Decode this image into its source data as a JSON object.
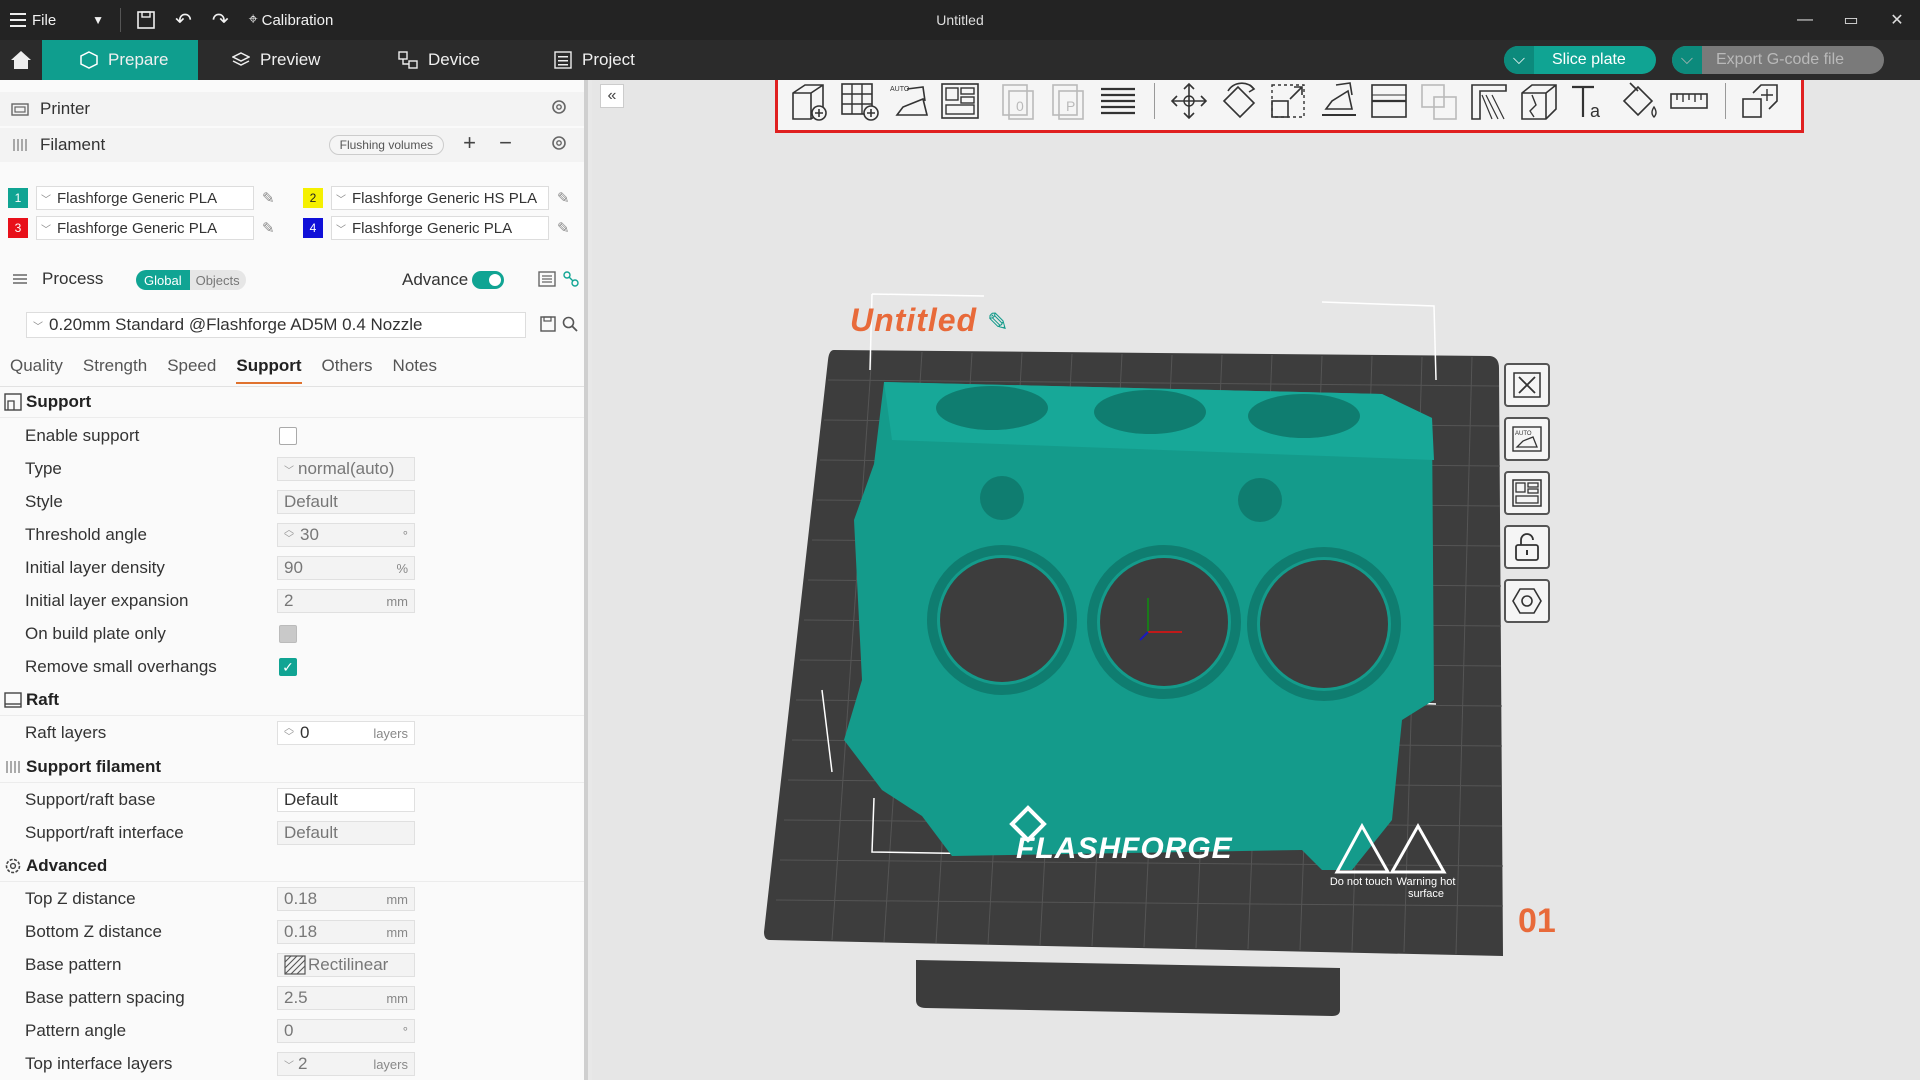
{
  "titlebar": {
    "file_label": "File",
    "calibration_label": "Calibration",
    "window_title": "Untitled"
  },
  "nav": {
    "tabs": [
      {
        "label": "Prepare"
      },
      {
        "label": "Preview"
      },
      {
        "label": "Device"
      },
      {
        "label": "Project"
      }
    ],
    "slice_label": "Slice plate",
    "export_label": "Export G-code file"
  },
  "sidebar": {
    "printer_label": "Printer",
    "filament_label": "Filament",
    "flushing_label": "Flushing volumes",
    "filaments": [
      {
        "num": "1",
        "color": "#10a493",
        "name": "Flashforge Generic PLA"
      },
      {
        "num": "2",
        "color": "#f5f000",
        "name": "Flashforge Generic HS PLA"
      },
      {
        "num": "3",
        "color": "#e8101a",
        "name": "Flashforge Generic PLA"
      },
      {
        "num": "4",
        "color": "#1010d8",
        "name": "Flashforge Generic PLA"
      }
    ],
    "process_label": "Process",
    "global_label": "Global",
    "objects_label": "Objects",
    "advance_label": "Advance",
    "preset_name": "0.20mm Standard @Flashforge AD5M 0.4 Nozzle",
    "tabs": [
      "Quality",
      "Strength",
      "Speed",
      "Support",
      "Others",
      "Notes"
    ],
    "groups": {
      "support": "Support",
      "raft": "Raft",
      "support_filament": "Support filament",
      "advanced": "Advanced"
    },
    "rows": {
      "enable_support": "Enable support",
      "type": "Type",
      "type_value": "normal(auto)",
      "style": "Style",
      "style_value": "Default",
      "threshold_angle": "Threshold angle",
      "threshold_value": "30",
      "threshold_unit": "°",
      "initial_density": "Initial layer density",
      "initial_density_value": "90",
      "initial_density_unit": "%",
      "initial_expansion": "Initial layer expansion",
      "initial_expansion_value": "2",
      "initial_expansion_unit": "mm",
      "build_plate_only": "On build plate only",
      "remove_small": "Remove small overhangs",
      "raft_layers": "Raft layers",
      "raft_layers_value": "0",
      "raft_layers_unit": "layers",
      "sf_base": "Support/raft base",
      "sf_base_value": "Default",
      "sf_interface": "Support/raft interface",
      "sf_interface_value": "Default",
      "top_z": "Top Z distance",
      "top_z_value": "0.18",
      "top_z_unit": "mm",
      "bottom_z": "Bottom Z distance",
      "bottom_z_value": "0.18",
      "bottom_z_unit": "mm",
      "base_pattern": "Base pattern",
      "base_pattern_value": "Rectilinear",
      "base_spacing": "Base pattern spacing",
      "base_spacing_value": "2.5",
      "base_spacing_unit": "mm",
      "pattern_angle": "Pattern angle",
      "pattern_angle_value": "0",
      "pattern_angle_unit": "°",
      "top_interface": "Top interface layers",
      "top_interface_value": "2",
      "top_interface_unit": "layers"
    }
  },
  "viewport": {
    "object_name": "Untitled",
    "plate_number": "01",
    "brand": "FLASHFORGE",
    "warn_touch": "Do not touch",
    "warn_hot": "Warning hot surface",
    "accent": "#e86a3a",
    "model_color": "#149b8b"
  }
}
